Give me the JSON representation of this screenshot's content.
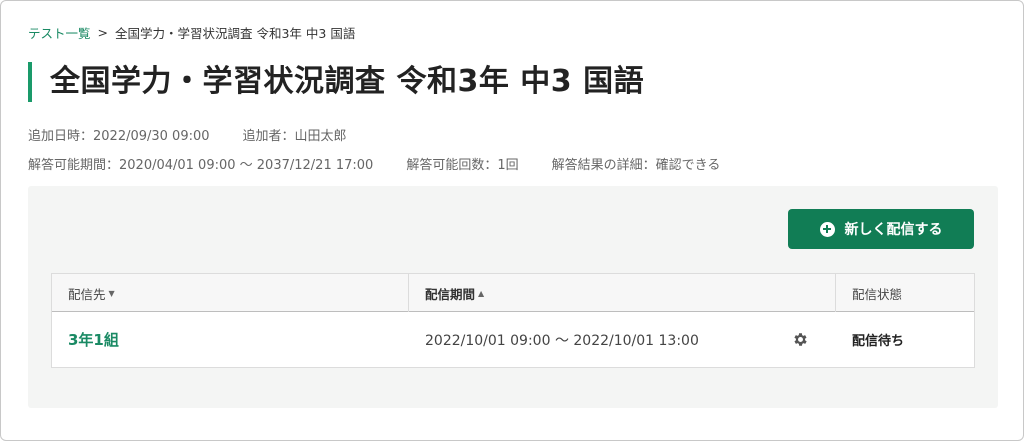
{
  "breadcrumb": {
    "link": "テスト一覧",
    "separator": ">",
    "current": "全国学力・学習状況調査 令和3年 中3 国語"
  },
  "page": {
    "title": "全国学力・学習状況調査 令和3年 中3 国語"
  },
  "meta": {
    "added_at": "追加日時：2022/09/30 09:00",
    "added_by": "追加者：山田太郎",
    "answer_period": "解答可能期間：2020/04/01 09:00 〜 2037/12/21 17:00",
    "answer_count": "解答可能回数：1回",
    "result_detail": "解答結果の詳細：確認できる"
  },
  "actions": {
    "new_delivery_label": "新しく配信する",
    "new_delivery_icon": "plus-circle-icon"
  },
  "table": {
    "headers": {
      "target": "配信先",
      "target_sort": "▼",
      "period": "配信期間",
      "period_sort": "▲",
      "status": "配信状態"
    },
    "rows": [
      {
        "target": "3年1組",
        "period": "2022/10/01 09:00 〜 2022/10/01 13:00",
        "settings_icon": "gear-icon",
        "status": "配信待ち"
      }
    ]
  },
  "colors": {
    "accent": "#117d55",
    "link": "#1a8a64",
    "title_bar": "#1a9a6a",
    "panel_bg": "#f4f5f4"
  }
}
